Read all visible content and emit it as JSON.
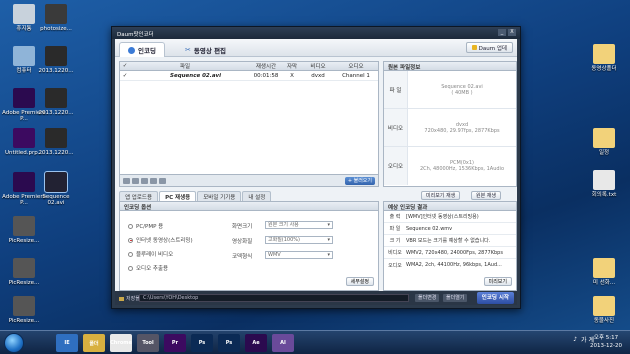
{
  "desktop": {
    "left_icons": [
      {
        "label": "휴지통",
        "color": "#c8d2dc"
      },
      {
        "label": "photosize...",
        "color": "#3a3a3a"
      },
      {
        "label": "컴퓨터",
        "color": "#8fb4d8"
      },
      {
        "label": "2013.1220...",
        "color": "#2a2a2a"
      },
      {
        "label": "Adobe Premiere P...",
        "color": "#2b0a4f"
      },
      {
        "label": "2013.1220...",
        "color": "#2a2a2a"
      },
      {
        "label": "Untitled.prp...",
        "color": "#3c0a60"
      },
      {
        "label": "2013.1220...",
        "color": "#2a2a2a"
      },
      {
        "label": "Adobe Premiere P...",
        "color": "#2b0a4f"
      },
      {
        "label": "Sequence 02.avi",
        "color": "#223"
      },
      {
        "label": "PicResize...",
        "color": "#555"
      },
      {
        "label": "PicResize...",
        "color": "#555"
      },
      {
        "label": "PicResize...",
        "color": "#555"
      }
    ],
    "right_icons": [
      {
        "label": "동영상폴더",
        "color": "#f2d27a"
      },
      {
        "label": "일정",
        "color": "#f2d27a"
      },
      {
        "label": "회의록.txt",
        "color": "#e8e8e8"
      },
      {
        "label": "미 선화...",
        "color": "#f2d27a"
      },
      {
        "label": "동물사진",
        "color": "#f2d27a"
      }
    ]
  },
  "window": {
    "title": "Daum팟인코더",
    "controls": {
      "minimize": "_",
      "close": "X"
    },
    "tabs": [
      {
        "label": "인코딩",
        "active": true
      },
      {
        "label": "동영상 편집",
        "active": false
      }
    ],
    "daum_update_label": "Daum 업데"
  },
  "file_table": {
    "headers": {
      "check": "✓",
      "file": "파일",
      "duration": "재생시간",
      "subtitle": "자막",
      "video": "비디오",
      "audio": "오디오"
    },
    "rows": [
      {
        "check": "✓",
        "file": "Sequence 02.avi",
        "duration": "00:01:58",
        "subtitle": "X",
        "video": "dvxd",
        "audio": "Channel 1"
      }
    ],
    "add_label": "+ 불러오기"
  },
  "source_info": {
    "title": "원본 파일정보",
    "rows": [
      {
        "label": "파 일",
        "lines": [
          "Sequence 02.avi",
          "( 40MB )"
        ]
      },
      {
        "label": "비디오",
        "lines": [
          "dvxd",
          "720x480, 29.97fps, 2877Kbps"
        ]
      },
      {
        "label": "오디오",
        "lines": [
          "PCM(0x1)",
          "2Ch, 48000Hz, 1536Kbps, 1Audio"
        ]
      }
    ]
  },
  "sub_tabs": [
    {
      "label": "앱 업로드용",
      "active": false
    },
    {
      "label": "PC 재생용",
      "active": true
    },
    {
      "label": "모바일 기기용",
      "active": false
    },
    {
      "label": "내 설정",
      "active": false
    }
  ],
  "right_buttons": {
    "preview": "미리보기 재생",
    "original": "원본 재생"
  },
  "options": {
    "title": "인코딩 옵션",
    "radios": [
      {
        "label": "PC/PMP 용",
        "selected": false
      },
      {
        "label": "인터넷 동영상(스트리밍)",
        "selected": true
      },
      {
        "label": "블루레이 비디오",
        "selected": false
      },
      {
        "label": "오디오 추출용",
        "selected": false
      }
    ],
    "fields": [
      {
        "label": "화면크기",
        "value": "원본 크기 사용"
      },
      {
        "label": "영상화질",
        "value": "고화질(100%)"
      },
      {
        "label": "코덱형식",
        "value": "WMV"
      }
    ],
    "detail_label": "세부설정"
  },
  "result": {
    "title": "예상 인코딩 결과",
    "rows": [
      {
        "label": "출 력",
        "value": "[WMV]인터넷 동영상(스트리밍용)"
      },
      {
        "label": "파 일",
        "value": "Sequence 02.wmv"
      },
      {
        "label": "크 기",
        "value": "VBR 모드는 크기를 예상할 수 없습니다."
      },
      {
        "label": "비디오",
        "value": "WMV2, 720x480, 24000Fps, 2877Kbps"
      },
      {
        "label": "오디오",
        "value": "WMA2, 2ch, 44100Hz, 96kbps, 1Aud..."
      }
    ],
    "reset_label": "미리보기"
  },
  "save_bar": {
    "label": "저장폴더",
    "path": "C:\\Users\\YOH\\Desktop",
    "btn1": "폴더변경",
    "btn2": "폴더열기",
    "start_label": "인코딩 시작"
  },
  "taskbar": {
    "apps": [
      "IE",
      "폴더",
      "Chrome",
      "Tool",
      "Pr",
      "Ps",
      "Ps",
      "Ae",
      "AI"
    ],
    "tray_text": "가 계",
    "time": "오후 5:17",
    "date": "2013-12-20"
  }
}
